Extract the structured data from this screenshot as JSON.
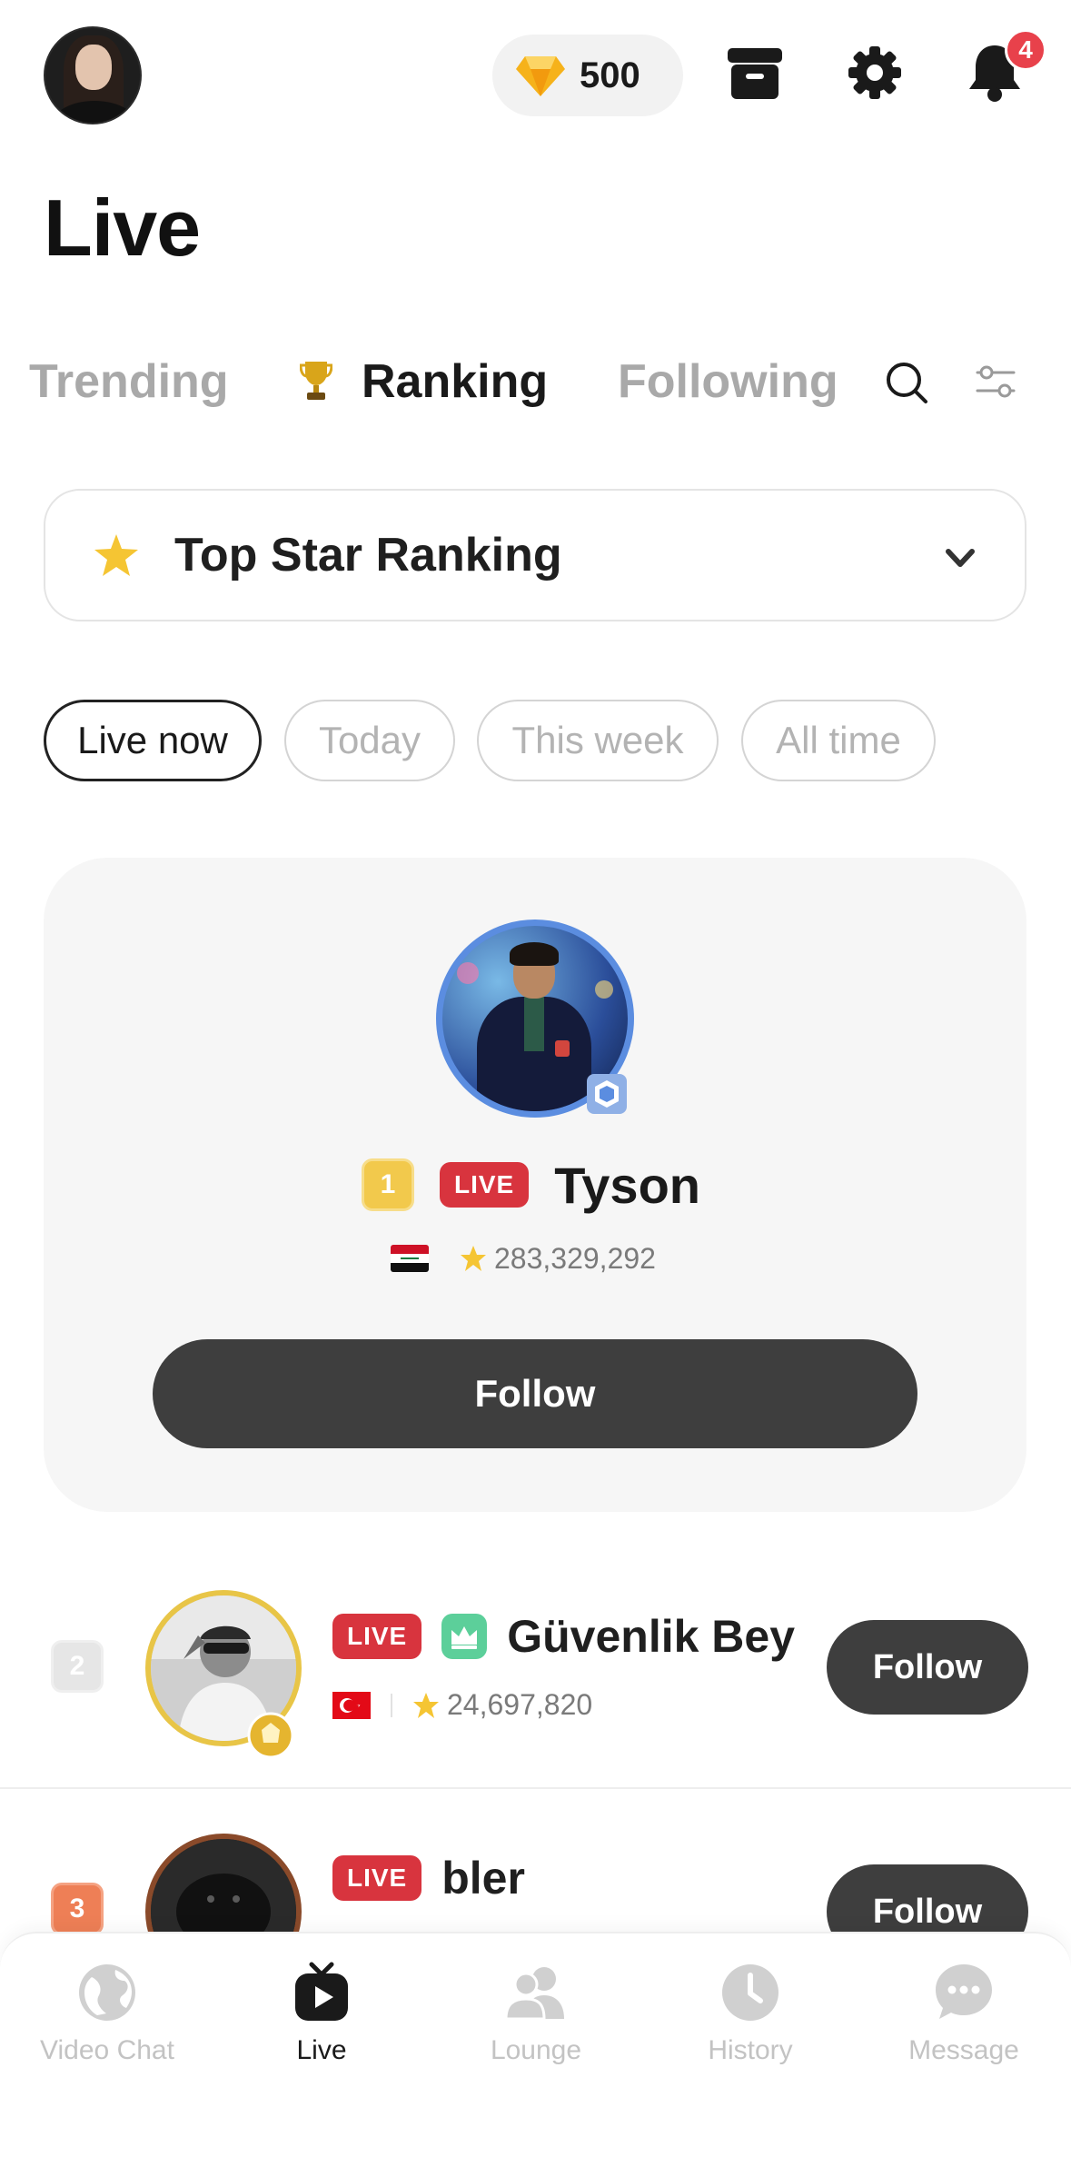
{
  "header": {
    "coins": "500",
    "notification_count": "4"
  },
  "page_title": "Live",
  "tabs": [
    {
      "label": "Trending",
      "active": false
    },
    {
      "label": "Ranking",
      "active": true
    },
    {
      "label": "Following",
      "active": false
    }
  ],
  "ranking_select": {
    "label": "Top Star Ranking"
  },
  "periods": [
    {
      "label": "Live now",
      "active": true
    },
    {
      "label": "Today",
      "active": false
    },
    {
      "label": "This week",
      "active": false
    },
    {
      "label": "All time",
      "active": false
    }
  ],
  "top_streamer": {
    "rank": "1",
    "live_label": "LIVE",
    "name": "Tyson",
    "stars": "283,329,292",
    "follow_label": "Follow",
    "ring_color": "#5b8de0"
  },
  "list": [
    {
      "rank": "2",
      "live_label": "LIVE",
      "name": "Güvenlik Bey",
      "stars": "24,697,820",
      "follow_label": "Follow",
      "ring_color": "#e8c547"
    },
    {
      "rank": "3",
      "live_label": "LIVE",
      "name": "bler",
      "follow_label": "Follow",
      "ring_color": "#8a4a2a"
    }
  ],
  "bottom_nav": [
    {
      "label": "Video Chat",
      "icon": "globe-icon",
      "active": false
    },
    {
      "label": "Live",
      "icon": "tv-play-icon",
      "active": true
    },
    {
      "label": "Lounge",
      "icon": "people-icon",
      "active": false
    },
    {
      "label": "History",
      "icon": "clock-icon",
      "active": false
    },
    {
      "label": "Message",
      "icon": "chat-bubble-icon",
      "active": false
    }
  ],
  "colors": {
    "accent_dark": "#3e3e3e",
    "live_red": "#d8343e",
    "gold": "#f2c94c",
    "badge_red": "#e8414b"
  }
}
